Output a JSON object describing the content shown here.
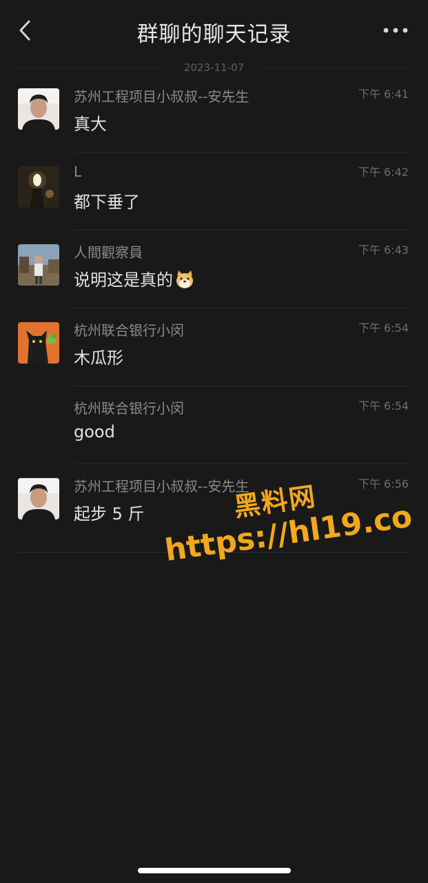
{
  "header": {
    "title": "群聊的聊天记录",
    "back_icon": "chevron-left-icon",
    "more_icon": "more-dots-icon"
  },
  "date_separator": "2023-11-07",
  "messages": [
    {
      "sender": "苏州工程项目小叔叔--安先生",
      "time": "下午 6:41",
      "content": "真大",
      "avatar": "person-photo-avatar"
    },
    {
      "sender": "L",
      "time": "下午 6:42",
      "content": "都下垂了",
      "avatar": "lamp-photo-avatar"
    },
    {
      "sender": "人間觀察員",
      "time": "下午 6:43",
      "content": "说明这是真的",
      "emoji": "doge-emoji-icon",
      "avatar": "outdoor-person-avatar"
    },
    {
      "sender": "杭州联合银行小闵",
      "time": "下午 6:54",
      "content": "木瓜形",
      "avatar": "black-cat-clover-avatar"
    },
    {
      "sender": "杭州联合银行小闵",
      "time": "下午 6:54",
      "content": "good",
      "avatar": ""
    },
    {
      "sender": "苏州工程项目小叔叔--安先生",
      "time": "下午 6:56",
      "content": "起步 5 斤",
      "avatar": "person-photo-avatar"
    }
  ],
  "watermark": {
    "name": "黑料网",
    "url": "https://hl19.co"
  },
  "colors": {
    "background": "#191919",
    "watermark": "#f2a81d"
  }
}
